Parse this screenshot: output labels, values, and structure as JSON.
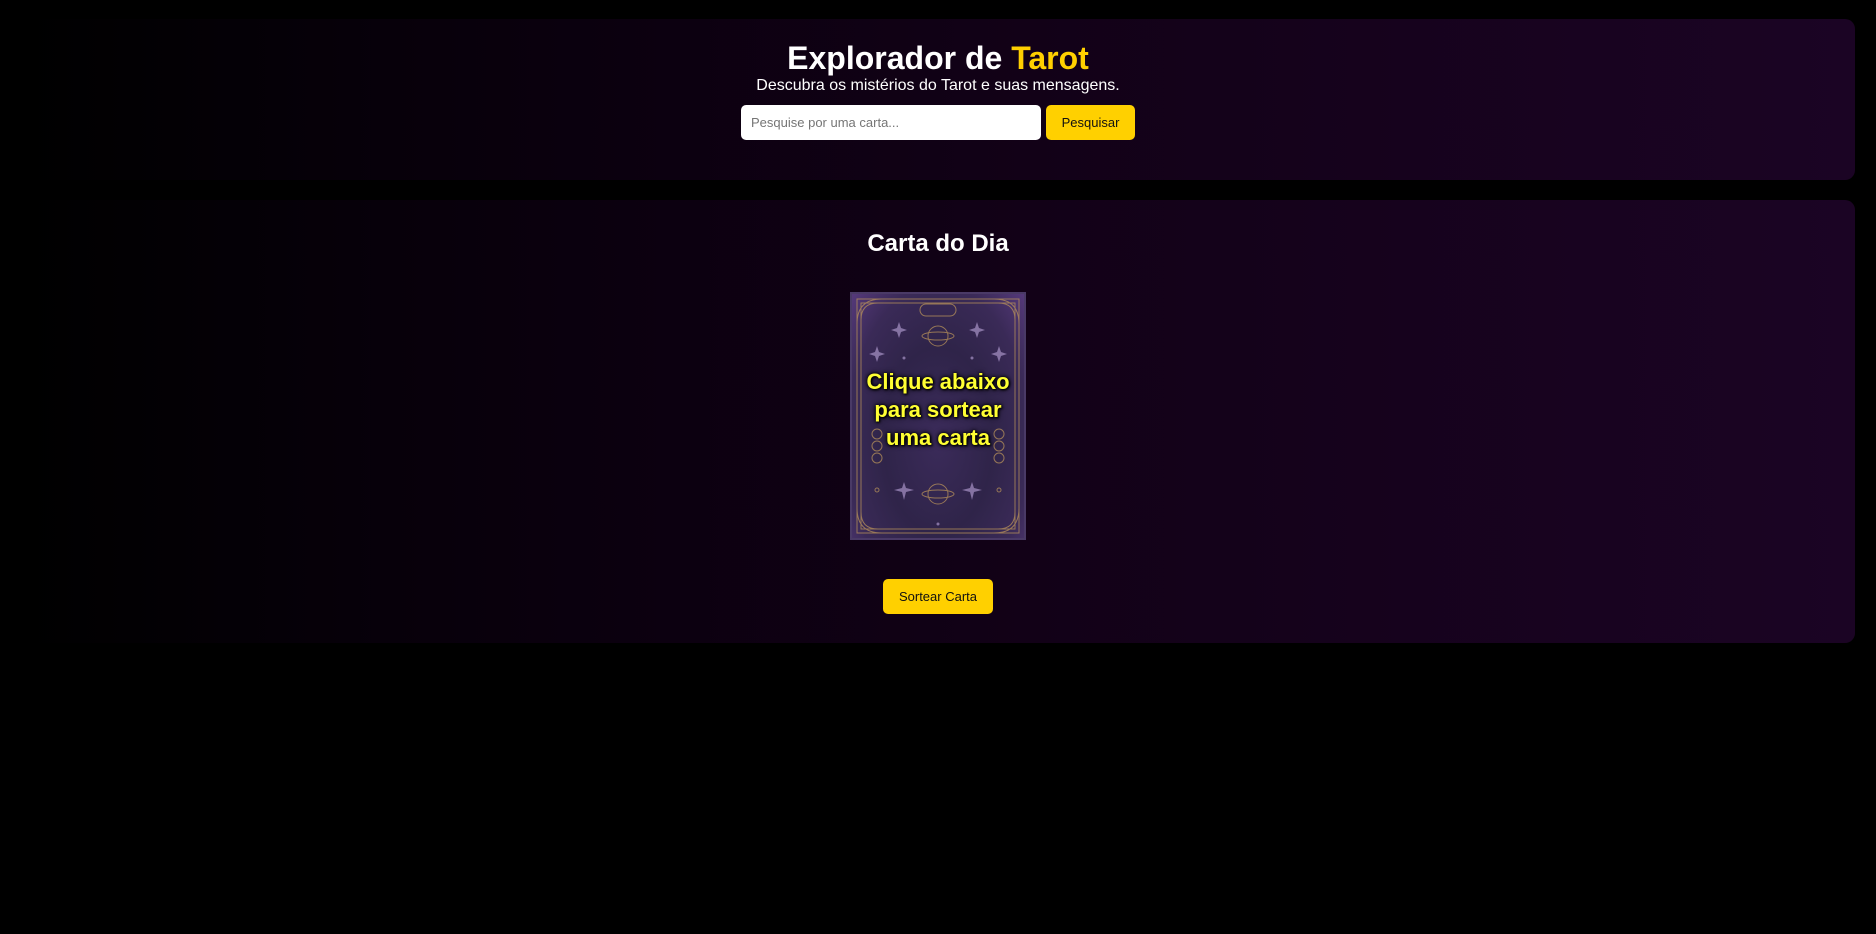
{
  "header": {
    "title_prefix": "Explorador de",
    "title_accent": "Tarot",
    "subtitle": "Descubra os mistérios do Tarot e suas mensagens."
  },
  "search": {
    "placeholder": "Pesquise por uma carta...",
    "value": "",
    "button_label": "Pesquisar"
  },
  "daily_card": {
    "heading": "Carta do Dia",
    "card_text": "Clique abaixo para sortear uma carta",
    "draw_button_label": "Sortear Carta"
  },
  "colors": {
    "accent": "#ffd000",
    "background": "#000000",
    "panel_gradient_end": "#1b0424",
    "card_text": "#ffff33"
  }
}
